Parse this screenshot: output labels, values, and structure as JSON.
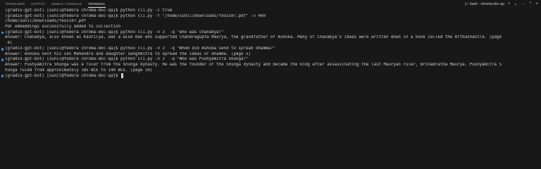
{
  "tabs": [
    {
      "label": "PROBLEMS",
      "active": false
    },
    {
      "label": "OUTPUT",
      "active": false
    },
    {
      "label": "DEBUG CONSOLE",
      "active": false
    },
    {
      "label": "TERMINAL",
      "active": true
    }
  ],
  "terminal_instance": "bash - chroma-doc-qa",
  "icons": {
    "add": "plus-icon",
    "dropdown": "chevron-down-icon",
    "more": "ellipsis-icon",
    "maximize": "chevron-up-icon",
    "close": "close-icon",
    "terminal": "terminal-icon"
  },
  "colors": {
    "background": "#181818",
    "text": "#cccccc",
    "prompt_dot": "#4a8fd3"
  },
  "terminal_lines": [
    {
      "text": "(gradio-gpt-bot) [sunil@fedora chroma-doc-qa]$ python cli.py -c true",
      "marker": false
    },
    {
      "text": "(gradio-gpt-bot) [sunil@fedora chroma-doc-qa]$ python cli.py -f \"/home/sunil/Downloads/fess107.pdf\" -v 400",
      "marker": false
    },
    {
      "text": "/home/sunil/Downloads/fess107.pdf",
      "marker": false
    },
    {
      "text": "PDF embeddings successfully added to collection",
      "marker": false
    },
    {
      "text": "(gradio-gpt-bot) [sunil@fedora chroma-doc-qa]$ python cli.py -n 3  -q \"who was chanakya?\"",
      "marker": true
    },
    {
      "text": "Answer: Chanakya, also known as Kautilya, was a wise man who supported Chandragupta Maurya, the grandfather of Ashoka. Many of Chanakya's ideas were written down in a book called the Arthashastra. (page",
      "marker": false
    },
    {
      "text": " 8)",
      "marker": false
    },
    {
      "text": "(gradio-gpt-bot) [sunil@fedora chroma-doc-qa]$ python cli.py -n 3  -q \"Whom did Ashoka send to spread dhamma?\"",
      "marker": true
    },
    {
      "text": "Answer: Ashoka sent his son Mahendra and daughter Sanghmitra to spread the ideas of dhamma. (page 5)",
      "marker": false
    },
    {
      "text": "(gradio-gpt-bot) [sunil@fedora chroma-doc-qa]$ python cli.py -n 3  -q \"Who was Pushyamitra Shunga?\"",
      "marker": true
    },
    {
      "text": "Answer: Pushyamitra Shunga was a ruler from the Shunga dynasty. He was the founder of the Shunga dynasty and became the king after assassinating the last Mauryan ruler, Brihadratha Maurya. Pushyamitra S",
      "marker": false
    },
    {
      "text": "hunga ruled from approximately 185 BCE to 149 BCE. (page 10)",
      "marker": false
    },
    {
      "text": "(gradio-gpt-bot) [sunil@fedora chroma-doc-qa]$ ",
      "marker": true,
      "cursor": true
    }
  ]
}
